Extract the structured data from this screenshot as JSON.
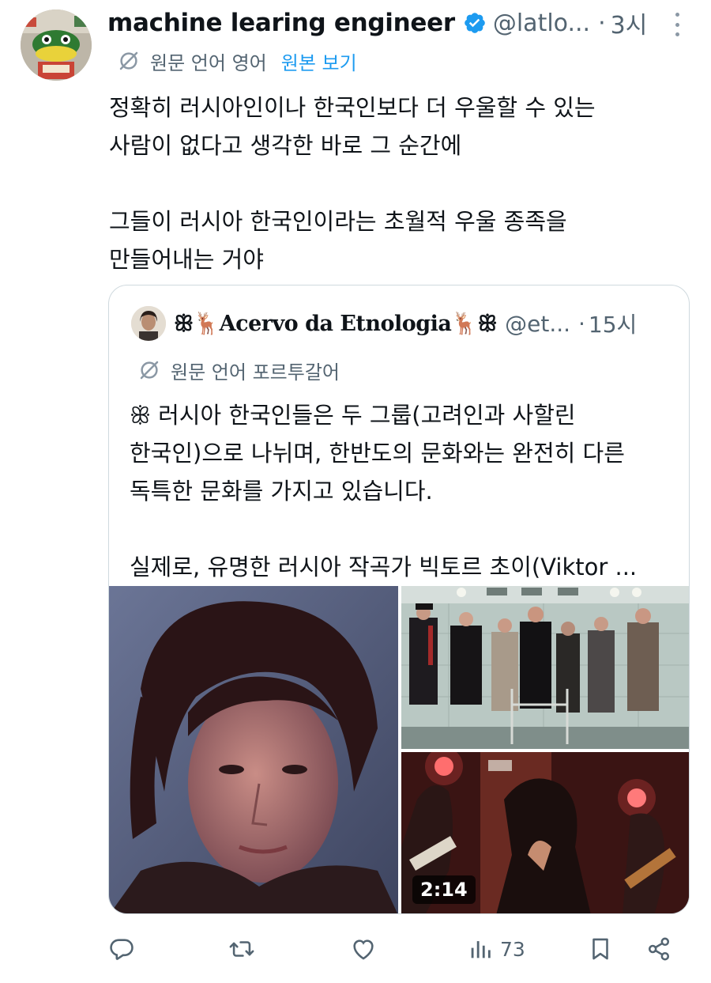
{
  "author": {
    "display_name": "machine learing engineer",
    "handle": "@latlo...",
    "time": "3시",
    "verified_color": "#1d9bf0"
  },
  "translation": {
    "source_label": "원문 언어 영어",
    "show_original_label": "원본 보기"
  },
  "tweet_text": {
    "line1": "정확히 러시아인이나 한국인보다 더 우울할 수 있는",
    "line2": "사람이 없다고 생각한 바로 그 순간에",
    "line3": "그들이 러시아 한국인이라는 초월적 우울 종족을",
    "line4": "만들어내는 거야"
  },
  "quoted": {
    "display_name": "ꕥ🦌Acervo da Etnologia🦌ꕥ",
    "handle": "@et...",
    "time": "15시",
    "translation_label": "원문 언어 포르투갈어",
    "text": {
      "line1": "ꕥ 러시아 한국인들은 두 그룹(고려인과 사할린",
      "line2": "한국인)으로 나뉘며, 한반도의 문화와는 완전히 다른",
      "line3": "독특한 문화를 가지고 있습니다.",
      "line4": "실제로, 유명한 러시아 작곡가 빅토르 초이(Viktor ..."
    },
    "video_duration": "2:14"
  },
  "action_bar": {
    "views_count": "73",
    "icons": [
      "reply-icon",
      "retweet-icon",
      "like-icon",
      "views-icon",
      "bookmark-icon",
      "share-icon"
    ]
  },
  "colors": {
    "text_primary": "#0f1419",
    "text_secondary": "#536471",
    "accent": "#1d9bf0",
    "border": "#cfd9de"
  }
}
